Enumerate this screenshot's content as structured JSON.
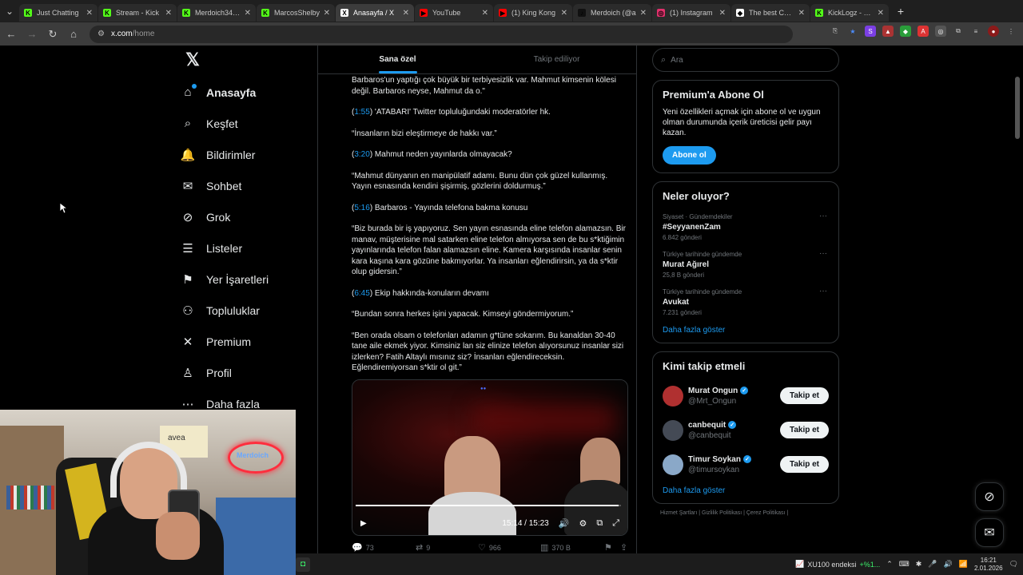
{
  "browser": {
    "tabs": [
      {
        "label": "Just Chatting",
        "color": "#53fc18",
        "glyph": "K"
      },
      {
        "label": "Stream - Kick",
        "color": "#53fc18",
        "glyph": "K"
      },
      {
        "label": "Merdoich34 St",
        "color": "#53fc18",
        "glyph": "K"
      },
      {
        "label": "MarcosShelby",
        "color": "#53fc18",
        "glyph": "K"
      },
      {
        "label": "Anasayfa / X",
        "color": "#ffffff",
        "glyph": "X"
      },
      {
        "label": "YouTube",
        "color": "#ff0000",
        "glyph": "▶"
      },
      {
        "label": "(1) King Kong",
        "color": "#ff0000",
        "glyph": "▶"
      },
      {
        "label": "Merdoich (@a",
        "color": "#111111",
        "glyph": "♪"
      },
      {
        "label": "(1) Instagram",
        "color": "#e1306c",
        "glyph": "◎"
      },
      {
        "label": "The best Chatt",
        "color": "#ffffff",
        "glyph": "◆"
      },
      {
        "label": "KickLogz - Kick",
        "color": "#53fc18",
        "glyph": "K"
      }
    ],
    "active_tab_index": 4,
    "url_host": "x.com",
    "url_path": "/home"
  },
  "leftnav": {
    "items": [
      {
        "label": "Anasayfa",
        "icon": "home-icon",
        "glyph": "⌂"
      },
      {
        "label": "Keşfet",
        "icon": "search-icon",
        "glyph": "⌕"
      },
      {
        "label": "Bildirimler",
        "icon": "bell-icon",
        "glyph": "🔔"
      },
      {
        "label": "Sohbet",
        "icon": "mail-icon",
        "glyph": "✉"
      },
      {
        "label": "Grok",
        "icon": "grok-icon",
        "glyph": "⊘"
      },
      {
        "label": "Listeler",
        "icon": "list-icon",
        "glyph": "☰"
      },
      {
        "label": "Yer İşaretleri",
        "icon": "bookmark-icon",
        "glyph": "⚑"
      },
      {
        "label": "Topluluklar",
        "icon": "community-icon",
        "glyph": "⚇"
      },
      {
        "label": "Premium",
        "icon": "x-icon",
        "glyph": "✕"
      },
      {
        "label": "Profil",
        "icon": "profile-icon",
        "glyph": "♙"
      },
      {
        "label": "Daha fazla",
        "icon": "more-icon",
        "glyph": "⋯"
      }
    ]
  },
  "timeline": {
    "tabs": [
      "Sana özel",
      "Takip ediliyor"
    ],
    "paragraphs": [
      {
        "ts": "",
        "text": "Barbaros'un yaptığı çok büyük bir terbiyesizlik var. Mahmut kimsenin kölesi değil. Barbaros neyse, Mahmut da o.\""
      },
      {
        "ts": "1:55",
        "text": "'ATABARI' Twitter topluluğundaki moderatörler hk."
      },
      {
        "ts": "",
        "text": "“İnsanların bizi eleştirmeye de hakkı var.”"
      },
      {
        "ts": "3:20",
        "text": "Mahmut neden yayınlarda olmayacak?"
      },
      {
        "ts": "",
        "text": "“Mahmut dünyanın en manipülatif adamı. Bunu dün çok güzel kullanmış. Yayın esnasında kendini şişirmiş, gözlerini doldurmuş.”"
      },
      {
        "ts": "5:16",
        "text": "Barbaros - Yayında telefona bakma konusu"
      },
      {
        "ts": "",
        "text": "“Biz burada bir iş yapıyoruz. Sen yayın esnasında eline telefon alamazsın. Bir manav, müşterisine mal satarken eline telefon almıyorsa sen de bu s*ktiğimin yayınlarında telefon falan alamazsın eline. Kamera karşısında insanlar senin kara kaşına kara gözüne bakmıyorlar. Ya insanları eğlendirirsin, ya da s*ktir olup gidersin.”"
      },
      {
        "ts": "6:45",
        "text": "Ekip hakkında-konuların devamı"
      },
      {
        "ts": "",
        "text": "“Bundan sonra herkes işini yapacak. Kimseyi göndermiyorum.”"
      },
      {
        "ts": "",
        "text": "“Ben orada olsam o telefonları adamın g*tüne sokarım. Bu kanaldan 30-40 tane aile ekmek yiyor. Kimsiniz lan siz elinize telefon alıyorsunuz insanlar sizi izlerken? Fatih Altaylı mısınız siz? İnsanları eğlendireceksin. Eğlendiremiyorsan s*ktir ol git.”"
      }
    ],
    "video": {
      "time": "15:14 / 15:23",
      "progress": 0.99
    },
    "actions": {
      "replies": "73",
      "reposts": "9",
      "likes": "966",
      "views": "370 B"
    }
  },
  "right": {
    "search_placeholder": "Ara",
    "premium": {
      "title": "Premium'a Abone Ol",
      "desc": "Yeni özellikleri açmak için abone ol ve uygun olman durumunda içerik üreticisi gelir payı kazan.",
      "button": "Abone ol"
    },
    "trends": {
      "title": "Neler oluyor?",
      "items": [
        {
          "meta": "Siyaset · Gündemdekiler",
          "name": "#SeyyanenZam",
          "count": "6.842 gönderi"
        },
        {
          "meta": "Türkiye tarihinde gündemde",
          "name": "Murat Ağırel",
          "count": "25,8 B gönderi"
        },
        {
          "meta": "Türkiye tarihinde gündemde",
          "name": "Avukat",
          "count": "7.231 gönderi"
        }
      ],
      "more": "Daha fazla göster"
    },
    "who_to_follow": {
      "title": "Kimi takip etmeli",
      "items": [
        {
          "name": "Murat Ongun",
          "handle": "@Mrt_Ongun",
          "color": "#b03030"
        },
        {
          "name": "canbequit",
          "handle": "@canbequit",
          "color": "#444a55"
        },
        {
          "name": "Timur Soykan",
          "handle": "@timursoykan",
          "color": "#8aa8c8"
        }
      ],
      "button": "Takip et",
      "more": "Daha fazla göster"
    },
    "footer": "Hizmet Şartları  |  Gizlilik Politikası  |  Çerez Politikası  |"
  },
  "taskbar": {
    "stock_name": "XU100 endeksi",
    "stock_change": "+%1...",
    "time": "16:21",
    "date": "2.01.2026"
  },
  "webcam": {
    "shirt_text": "avea",
    "neon_text": "Merdoich"
  }
}
